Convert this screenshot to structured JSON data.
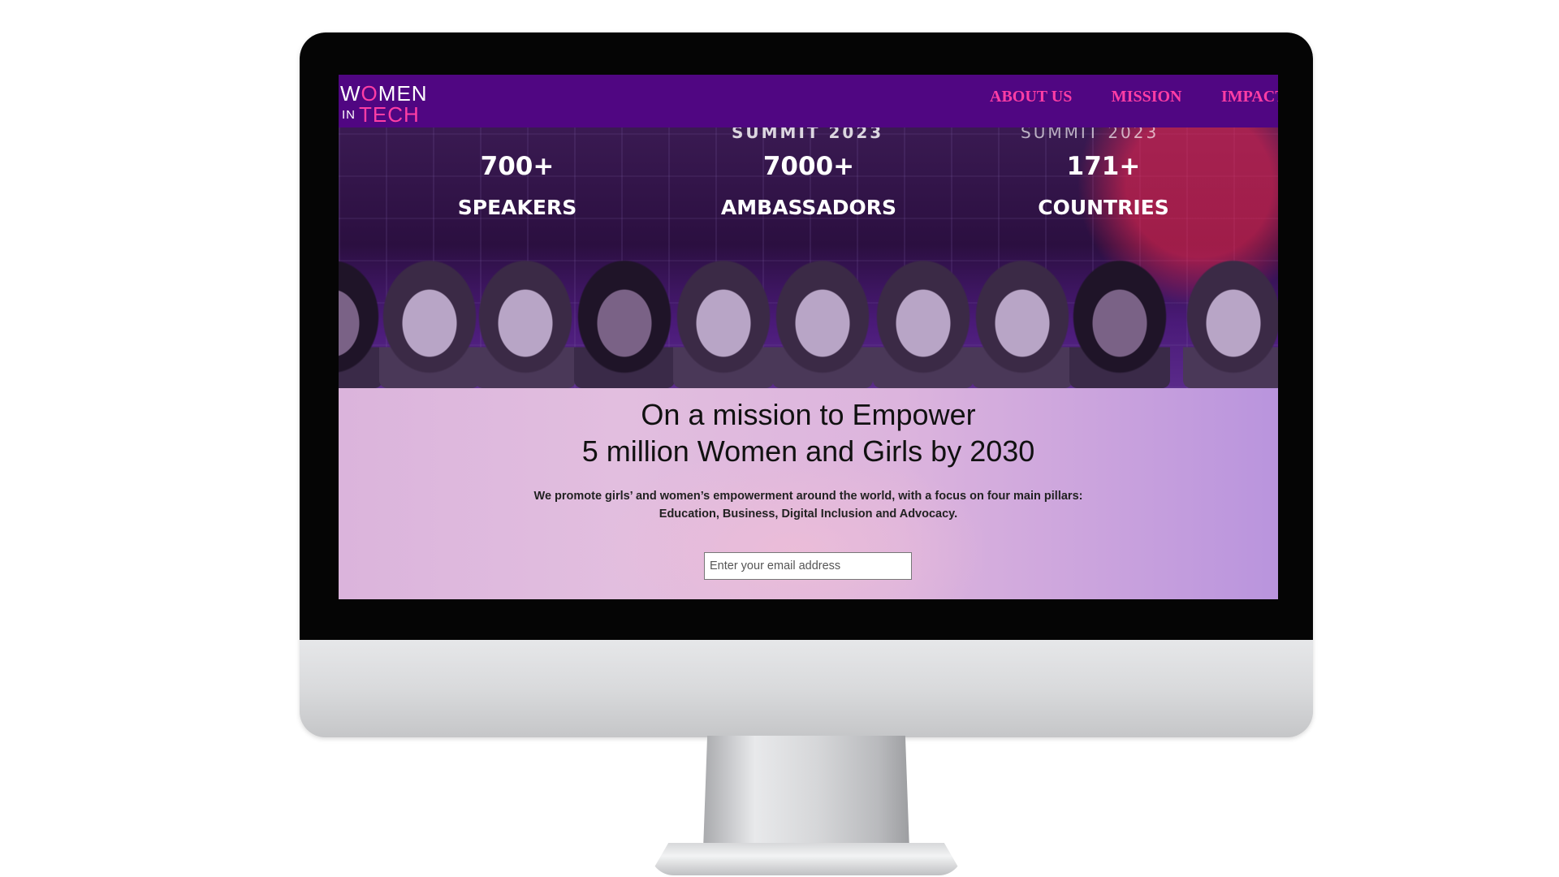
{
  "logo": {
    "line1_w": "W",
    "line1_o": "O",
    "line1_rest": "MEN",
    "line2_in": "IN",
    "line2_tech": "TECH"
  },
  "nav": {
    "links": [
      "ABOUT US",
      "MISSION",
      "IMPACT"
    ]
  },
  "hero": {
    "summit_left": "SUMMIT 2023",
    "summit_right": "SUMMIT 2023",
    "stats": [
      {
        "number": "700+",
        "label": "SPEAKERS"
      },
      {
        "number": "7000+",
        "label": "AMBASSADORS"
      },
      {
        "number": "171+",
        "label": "COUNTRIES"
      }
    ]
  },
  "mission": {
    "title_line1": "On a mission to Empower",
    "title_line2": "5 million Women and Girls by 2030",
    "text_line1": "We promote girls’ and women’s empowerment around the world, with a focus on four main pillars:",
    "text_line2": "Education, Business, Digital Inclusion and Advocacy.",
    "email_placeholder": "Enter your email address"
  },
  "colors": {
    "nav_bg": "#500682",
    "accent_pink": "#ff3ea5"
  }
}
